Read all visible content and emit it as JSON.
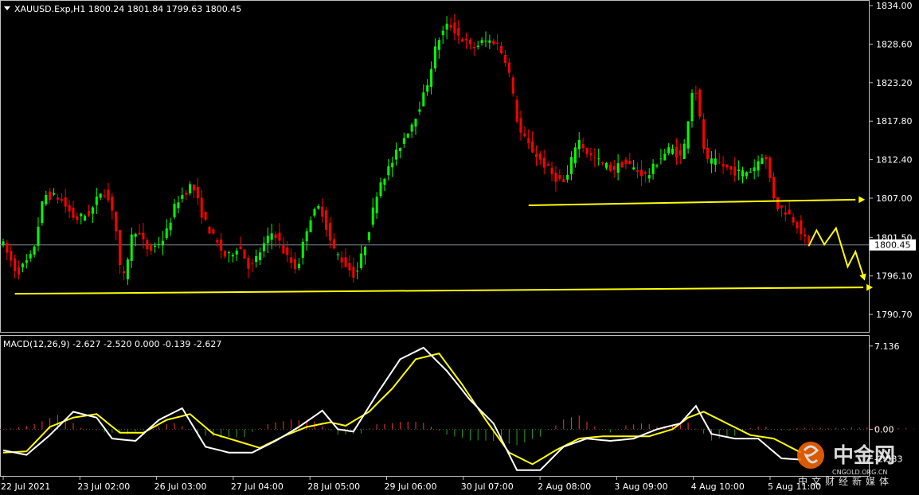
{
  "chart_data": [
    {
      "type": "candlestick",
      "symbol_header": "XAUUSD.Exp,H1  1800.24 1801.84 1799.63 1800.45",
      "y_ticks": [
        "1834.00",
        "1828.60",
        "1823.20",
        "1817.80",
        "1812.40",
        "1807.00",
        "1801.50",
        "1796.10",
        "1790.70"
      ],
      "ylim": [
        1789.6,
        1834.0
      ],
      "current_price_label": "1800.45",
      "current_price": 1800.45,
      "x_ticks": [
        "22 Jul 2021",
        "23 Jul 02:00",
        "26 Jul 03:00",
        "27 Jul 04:00",
        "28 Jul 05:00",
        "29 Jul 06:00",
        "30 Jul 07:00",
        "2 Aug 08:00",
        "3 Aug 09:00",
        "4 Aug 10:00",
        "5 Aug 11:00"
      ],
      "price_path": [
        [
          0,
          1801.0
        ],
        [
          4,
          1796.5
        ],
        [
          8,
          1799.0
        ],
        [
          11,
          1807.5
        ],
        [
          15,
          1807.0
        ],
        [
          19,
          1804.0
        ],
        [
          23,
          1805.0
        ],
        [
          26,
          1808.5
        ],
        [
          29,
          1805.0
        ],
        [
          31,
          1794.5
        ],
        [
          34,
          1803.0
        ],
        [
          38,
          1799.5
        ],
        [
          42,
          1801.5
        ],
        [
          45,
          1806.5
        ],
        [
          49,
          1809.0
        ],
        [
          52,
          1804.0
        ],
        [
          55,
          1801.0
        ],
        [
          58,
          1798.5
        ],
        [
          61,
          1800.5
        ],
        [
          64,
          1797.0
        ],
        [
          67,
          1800.0
        ],
        [
          70,
          1802.5
        ],
        [
          73,
          1799.0
        ],
        [
          76,
          1797.0
        ],
        [
          79,
          1804.0
        ],
        [
          82,
          1806.0
        ],
        [
          85,
          1800.0
        ],
        [
          88,
          1798.0
        ],
        [
          91,
          1796.0
        ],
        [
          94,
          1801.5
        ],
        [
          97,
          1809.0
        ],
        [
          100,
          1811.5
        ],
        [
          103,
          1815.0
        ],
        [
          106,
          1818.0
        ],
        [
          109,
          1822.0
        ],
        [
          112,
          1829.0
        ],
        [
          115,
          1831.5
        ],
        [
          118,
          1829.5
        ],
        [
          121,
          1828.0
        ],
        [
          124,
          1829.0
        ],
        [
          127,
          1829.0
        ],
        [
          130,
          1826.0
        ],
        [
          133,
          1816.5
        ],
        [
          136,
          1814.0
        ],
        [
          139,
          1812.0
        ],
        [
          142,
          1810.0
        ],
        [
          145,
          1809.0
        ],
        [
          148,
          1815.5
        ],
        [
          151,
          1813.0
        ],
        [
          154,
          1812.0
        ],
        [
          157,
          1811.0
        ],
        [
          160,
          1812.0
        ],
        [
          163,
          1811.0
        ],
        [
          166,
          1810.0
        ],
        [
          169,
          1812.5
        ],
        [
          172,
          1814.0
        ],
        [
          175,
          1812.5
        ],
        [
          178,
          1824.0
        ],
        [
          181,
          1812.0
        ],
        [
          184,
          1812.0
        ],
        [
          187,
          1811.0
        ],
        [
          190,
          1810.5
        ],
        [
          193,
          1811.0
        ],
        [
          196,
          1813.5
        ],
        [
          199,
          1806.0
        ],
        [
          202,
          1805.0
        ],
        [
          205,
          1803.0
        ],
        [
          207,
          1800.5
        ]
      ],
      "support_line": {
        "start": [
          3,
          1793.6
        ],
        "end": [
          221,
          1794.5
        ]
      },
      "resistance_line": {
        "start": [
          135,
          1806.0
        ],
        "end": [
          219,
          1806.8
        ]
      },
      "projection_path": [
        [
          207,
          1800.3
        ],
        [
          209,
          1802.5
        ],
        [
          211,
          1800.5
        ],
        [
          214,
          1802.8
        ],
        [
          217,
          1797.4
        ],
        [
          219,
          1799.5
        ],
        [
          221,
          1796.1
        ]
      ],
      "colors": {
        "bull": "#00ff00",
        "bear": "#ff0000",
        "lines": "#ffff00",
        "axis": "#c0c0c0"
      }
    },
    {
      "type": "line",
      "indicator_header": "MACD(12,26,9) -2.627 -2.520 0.000 -0.139 -2.627",
      "y_ticks": [
        "7.136",
        "0.00",
        "-2.533"
      ],
      "ylim": [
        -4.0,
        7.6
      ],
      "zero_label": "0.00",
      "macd_path": [
        [
          0,
          -1.8
        ],
        [
          6,
          -2.2
        ],
        [
          12,
          -0.5
        ],
        [
          18,
          1.5
        ],
        [
          24,
          1.0
        ],
        [
          28,
          -0.8
        ],
        [
          34,
          -1.0
        ],
        [
          40,
          0.8
        ],
        [
          46,
          1.8
        ],
        [
          52,
          -1.5
        ],
        [
          58,
          -2.0
        ],
        [
          64,
          -2.0
        ],
        [
          70,
          -1.0
        ],
        [
          76,
          0.2
        ],
        [
          82,
          1.6
        ],
        [
          86,
          0.0
        ],
        [
          90,
          -0.2
        ],
        [
          96,
          3.0
        ],
        [
          102,
          6.0
        ],
        [
          108,
          7.0
        ],
        [
          114,
          5.0
        ],
        [
          120,
          2.5
        ],
        [
          126,
          0.5
        ],
        [
          132,
          -3.5
        ],
        [
          138,
          -3.5
        ],
        [
          144,
          -1.5
        ],
        [
          150,
          -0.8
        ],
        [
          156,
          -1.0
        ],
        [
          162,
          -0.8
        ],
        [
          168,
          0.0
        ],
        [
          174,
          0.5
        ],
        [
          178,
          2.0
        ],
        [
          182,
          -0.4
        ],
        [
          188,
          -0.8
        ],
        [
          194,
          -0.8
        ],
        [
          200,
          -2.5
        ],
        [
          205,
          -2.6
        ]
      ],
      "signal_path": [
        [
          0,
          -2.0
        ],
        [
          6,
          -1.9
        ],
        [
          12,
          0.2
        ],
        [
          18,
          1.0
        ],
        [
          24,
          1.3
        ],
        [
          30,
          -0.3
        ],
        [
          36,
          -0.3
        ],
        [
          42,
          0.8
        ],
        [
          48,
          1.3
        ],
        [
          54,
          -0.4
        ],
        [
          60,
          -1.0
        ],
        [
          66,
          -1.6
        ],
        [
          72,
          -0.6
        ],
        [
          78,
          0.2
        ],
        [
          84,
          0.6
        ],
        [
          88,
          0.3
        ],
        [
          94,
          1.5
        ],
        [
          100,
          3.5
        ],
        [
          106,
          6.0
        ],
        [
          112,
          6.5
        ],
        [
          118,
          3.8
        ],
        [
          124,
          0.8
        ],
        [
          130,
          -2.0
        ],
        [
          136,
          -3.0
        ],
        [
          142,
          -1.8
        ],
        [
          148,
          -0.8
        ],
        [
          154,
          -0.6
        ],
        [
          160,
          -0.6
        ],
        [
          166,
          -0.6
        ],
        [
          172,
          0.0
        ],
        [
          176,
          1.0
        ],
        [
          180,
          1.5
        ],
        [
          186,
          0.5
        ],
        [
          192,
          -0.5
        ],
        [
          198,
          -0.8
        ],
        [
          205,
          -2.0
        ]
      ],
      "hist_anchors": [
        [
          0,
          0.0
        ],
        [
          8,
          0.4
        ],
        [
          14,
          1.2
        ],
        [
          20,
          0.2
        ],
        [
          26,
          -0.3
        ],
        [
          32,
          -0.4
        ],
        [
          38,
          0.1
        ],
        [
          44,
          0.6
        ],
        [
          50,
          -0.4
        ],
        [
          56,
          -0.7
        ],
        [
          62,
          -0.6
        ],
        [
          68,
          0.4
        ],
        [
          74,
          0.8
        ],
        [
          80,
          0.6
        ],
        [
          86,
          -0.4
        ],
        [
          92,
          -0.3
        ],
        [
          96,
          0.4
        ],
        [
          102,
          0.7
        ],
        [
          108,
          0.5
        ],
        [
          114,
          -0.5
        ],
        [
          120,
          -0.9
        ],
        [
          126,
          -1.0
        ],
        [
          132,
          -1.4
        ],
        [
          138,
          -0.6
        ],
        [
          144,
          0.9
        ],
        [
          148,
          1.1
        ],
        [
          152,
          0.3
        ],
        [
          156,
          -0.2
        ],
        [
          160,
          0.3
        ],
        [
          164,
          0.5
        ],
        [
          170,
          0.2
        ],
        [
          176,
          0.6
        ],
        [
          182,
          -0.9
        ],
        [
          188,
          -0.5
        ],
        [
          194,
          0.3
        ],
        [
          200,
          -0.1
        ],
        [
          206,
          0.1
        ]
      ],
      "colors": {
        "macd": "#ffffff",
        "signal": "#ffff00",
        "hist_pos": "#ff3030",
        "hist_neg": "#20a020"
      }
    }
  ],
  "watermark": {
    "text": "中金网",
    "subtitle": "中文财经新媒体",
    "url": "CNGOLD.ORG.CN"
  }
}
